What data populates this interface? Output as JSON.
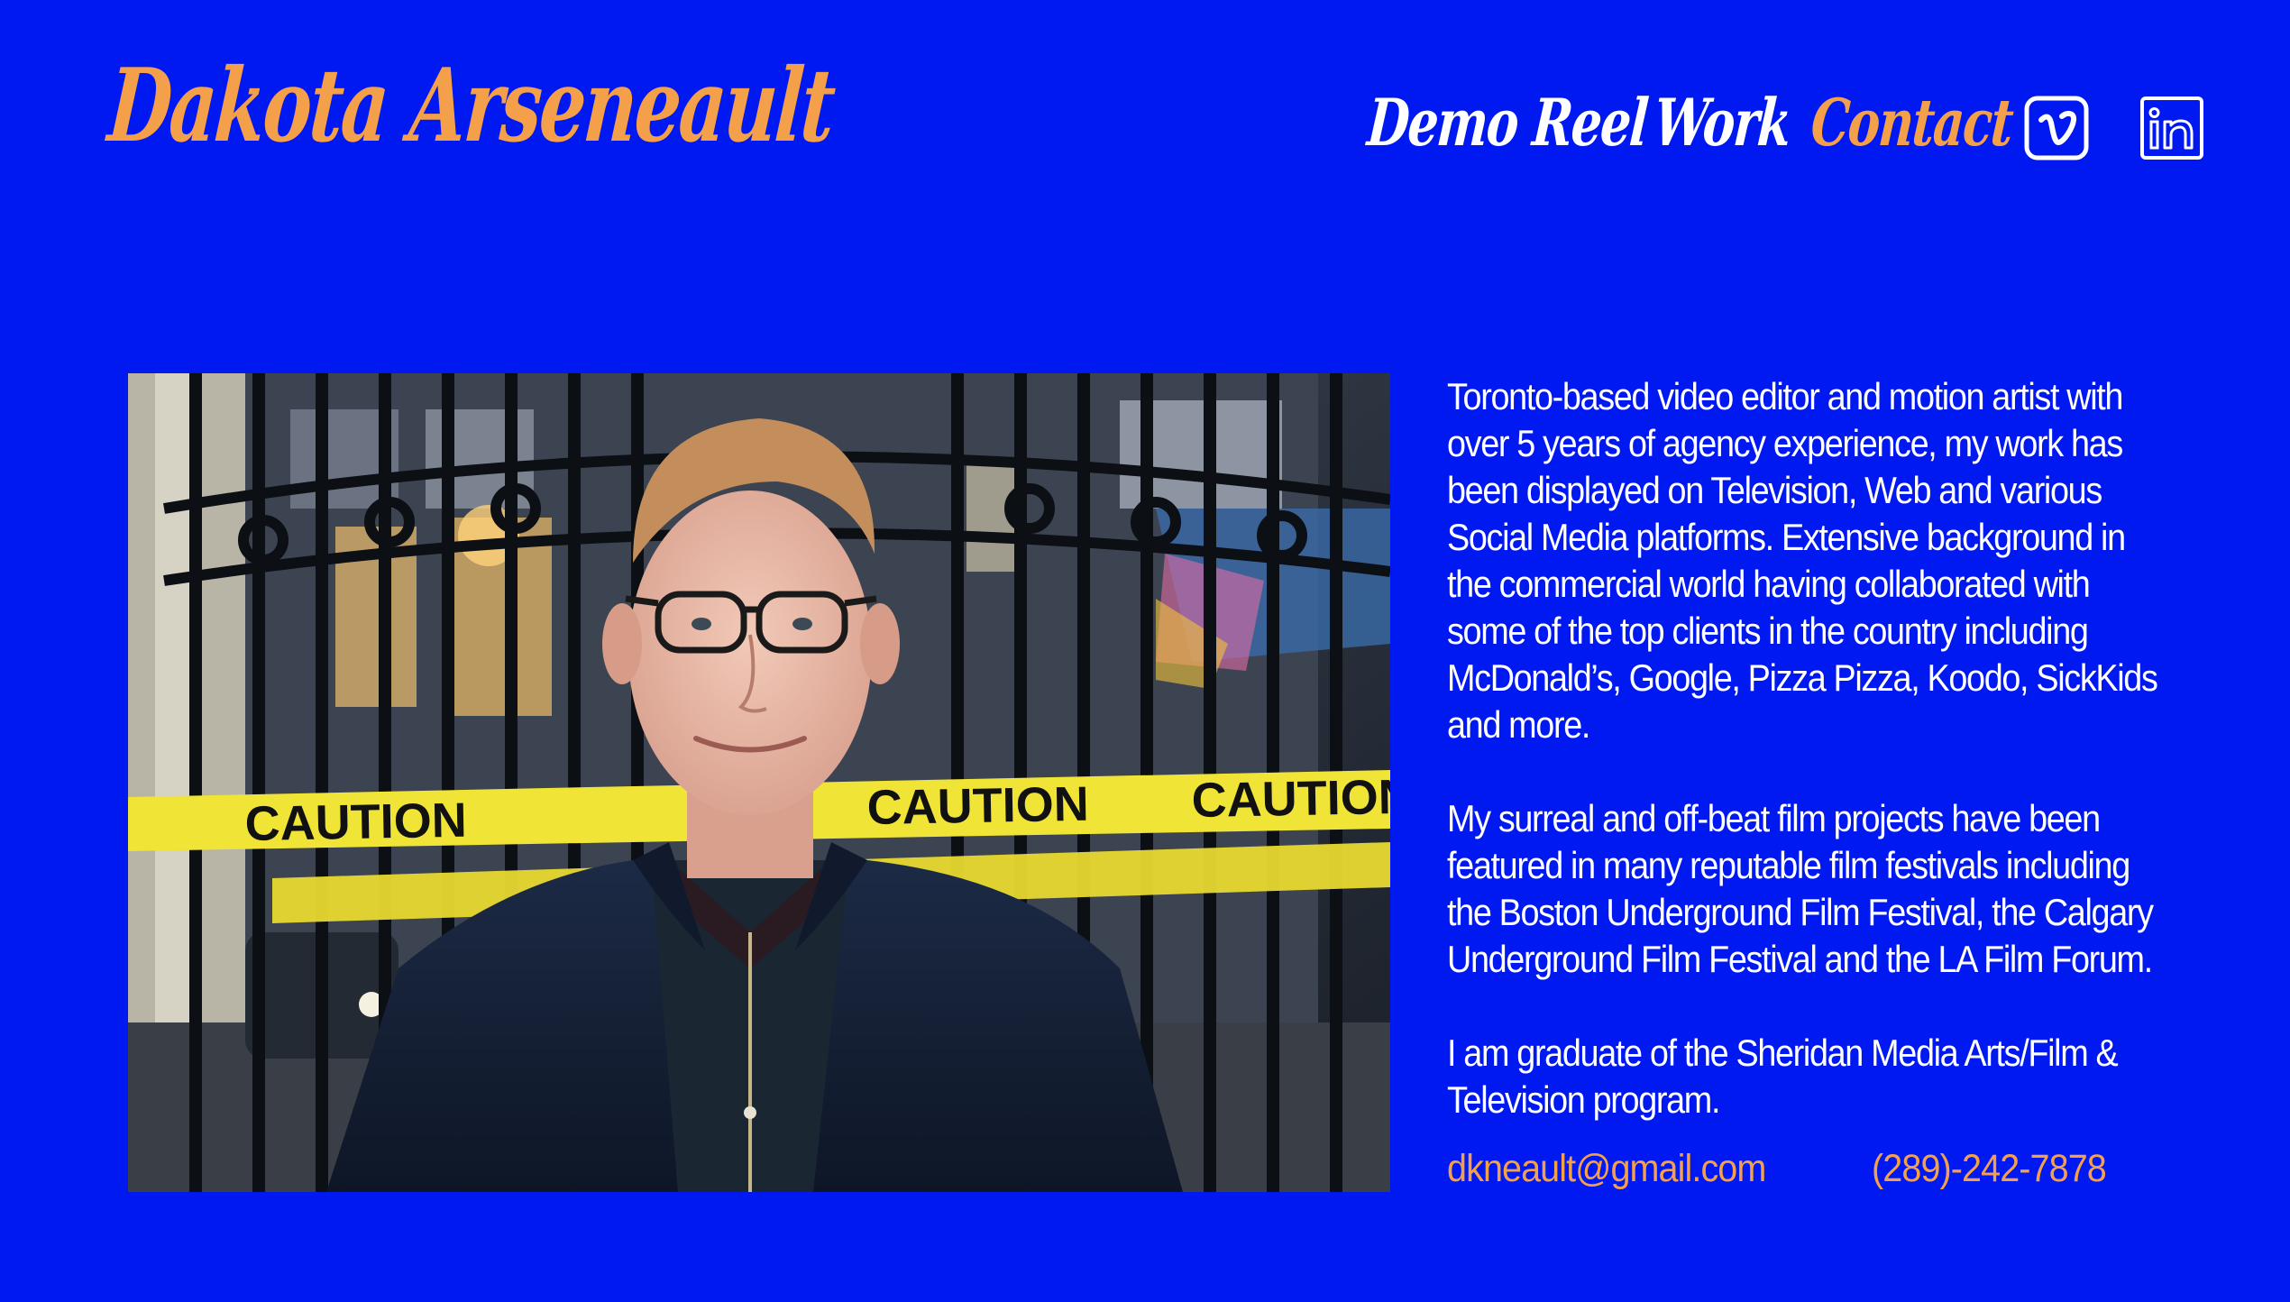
{
  "site": {
    "name": "Dakota Arseneault"
  },
  "nav": {
    "items": [
      {
        "label": "Demo Reel"
      },
      {
        "label": "Work"
      },
      {
        "label": "Contact",
        "active": true
      }
    ],
    "social": [
      {
        "icon": "vimeo-icon"
      },
      {
        "icon": "linkedin-icon"
      }
    ]
  },
  "photo": {
    "caution_text": "CAUTION"
  },
  "bio": {
    "paragraphs": [
      "Toronto-based video editor and motion artist with over 5 years of agency experience, my work has been displayed on Television, Web and various Social Media platforms. Extensive background in the commercial world having collaborated with some of the top clients in the country including McDonald’s, Google, Pizza Pizza, Koodo, SickKids and more.",
      "My surreal and off-beat film projects have been featured in many reputable film festivals including the Boston Underground Film Festival, the Calgary Underground Film Festival and the LA Film Forum.",
      "I am graduate of the Sheridan Media Arts/Film & Television program."
    ]
  },
  "contact": {
    "email": "dkneault@gmail.com",
    "phone": "(289)-242-7878"
  },
  "colors": {
    "background": "#0019f0",
    "accent": "#f4a04a",
    "text": "#ffffff"
  }
}
